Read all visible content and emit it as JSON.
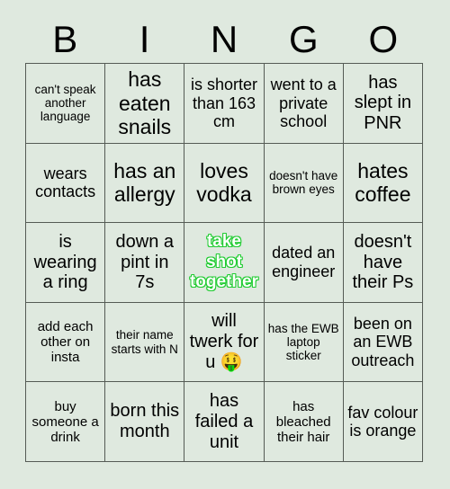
{
  "header": {
    "letters": [
      "B",
      "I",
      "N",
      "G",
      "O"
    ]
  },
  "colors": {
    "background": "#dfe9df",
    "cell_background": "#dfe9df",
    "border": "#555b55",
    "text": "#000000",
    "free_space_text": "#22cc33",
    "free_space_fill": "#ffffff"
  },
  "grid": {
    "columns": 5,
    "rows": 5,
    "cells": [
      {
        "text": "can't speak another language",
        "size": "fs-xs",
        "free": false
      },
      {
        "text": "has eaten snails",
        "size": "fs-xl",
        "free": false
      },
      {
        "text": "is shorter than 163 cm",
        "size": "fs-md",
        "free": false
      },
      {
        "text": "went to a private school",
        "size": "fs-md",
        "free": false
      },
      {
        "text": "has slept in PNR",
        "size": "fs-lg",
        "free": false
      },
      {
        "text": "wears contacts",
        "size": "fs-md",
        "free": false
      },
      {
        "text": "has an allergy",
        "size": "fs-xl",
        "free": false
      },
      {
        "text": "loves vodka",
        "size": "fs-xl",
        "free": false
      },
      {
        "text": "doesn't have brown eyes",
        "size": "fs-xs",
        "free": false
      },
      {
        "text": "hates coffee",
        "size": "fs-xl",
        "free": false
      },
      {
        "text": "is wearing a ring",
        "size": "fs-lg",
        "free": false
      },
      {
        "text": "down a pint in 7s",
        "size": "fs-lg",
        "free": false
      },
      {
        "text": "take shot together",
        "size": "fs-lg",
        "free": true
      },
      {
        "text": "dated an engineer",
        "size": "fs-md",
        "free": false
      },
      {
        "text": "doesn't have their Ps",
        "size": "fs-lg",
        "free": false
      },
      {
        "text": "add each other on insta",
        "size": "fs-sm",
        "free": false
      },
      {
        "text": "their name starts with N",
        "size": "fs-xs",
        "free": false
      },
      {
        "text": "will twerk for u 🤑",
        "size": "fs-lg",
        "free": false
      },
      {
        "text": "has the EWB laptop sticker",
        "size": "fs-xs",
        "free": false
      },
      {
        "text": "been on an EWB outreach",
        "size": "fs-md",
        "free": false
      },
      {
        "text": "buy someone a drink",
        "size": "fs-sm",
        "free": false
      },
      {
        "text": "born this month",
        "size": "fs-lg",
        "free": false
      },
      {
        "text": "has failed a unit",
        "size": "fs-lg",
        "free": false
      },
      {
        "text": "has bleached their hair",
        "size": "fs-sm",
        "free": false
      },
      {
        "text": "fav colour is orange",
        "size": "fs-md",
        "free": false
      }
    ]
  }
}
